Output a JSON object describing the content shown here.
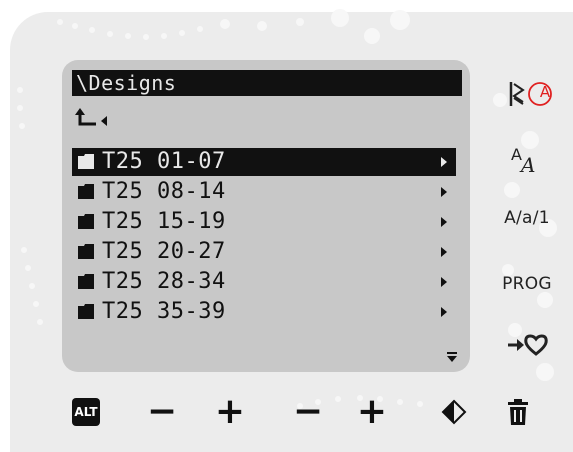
{
  "screen": {
    "title": "Designs",
    "items": [
      {
        "label": "T25 01-07",
        "selected": true
      },
      {
        "label": "T25 08-14",
        "selected": false
      },
      {
        "label": "T25 15-19",
        "selected": false
      },
      {
        "label": "T25 20-27",
        "selected": false
      },
      {
        "label": "T25 28-34",
        "selected": false
      },
      {
        "label": "T25 35-39",
        "selected": false
      }
    ]
  },
  "side_buttons": {
    "marker_label": "A",
    "case_label": "A/a/1",
    "prog_label": "PROG"
  },
  "bottom_buttons": {
    "alt_label": "ALT",
    "minus_1": "−",
    "plus_1": "+",
    "minus_2": "−",
    "plus_2": "+"
  },
  "icons": {
    "folder": "folder-icon",
    "up": "parent-folder-icon",
    "left": "left-arrow-icon",
    "right": "right-arrow-icon",
    "scroll": "scroll-down-icon",
    "stitch": "stitch-zigzag-icon",
    "font": "font-script-icon",
    "favorite": "save-to-favorites-icon",
    "mirror": "mirror-icon",
    "delete": "trash-icon"
  },
  "colors": {
    "panel": "#ececec",
    "lcd": "#c8c8c8",
    "ink": "#111111",
    "marker": "#e02020"
  }
}
